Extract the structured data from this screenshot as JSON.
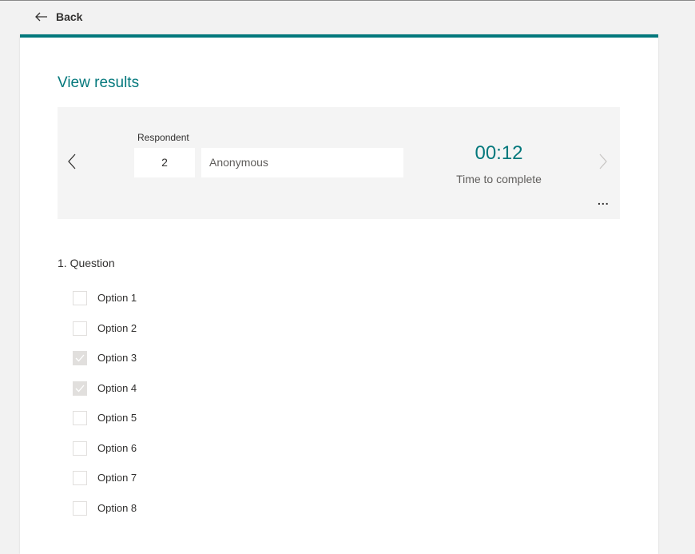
{
  "header": {
    "back_label": "Back"
  },
  "page": {
    "title": "View results"
  },
  "respondent": {
    "label": "Respondent",
    "number": "2",
    "name": "Anonymous",
    "time_value": "00:12",
    "time_label": "Time to complete",
    "more_label": "..."
  },
  "question": {
    "title": "1. Question",
    "options": [
      {
        "label": "Option 1",
        "checked": false
      },
      {
        "label": "Option 2",
        "checked": false
      },
      {
        "label": "Option 3",
        "checked": true
      },
      {
        "label": "Option 4",
        "checked": true
      },
      {
        "label": "Option 5",
        "checked": false
      },
      {
        "label": "Option 6",
        "checked": false
      },
      {
        "label": "Option 7",
        "checked": false
      },
      {
        "label": "Option 8",
        "checked": false
      }
    ]
  },
  "colors": {
    "accent": "#03787c",
    "checked_box": "#e1dfdd"
  }
}
